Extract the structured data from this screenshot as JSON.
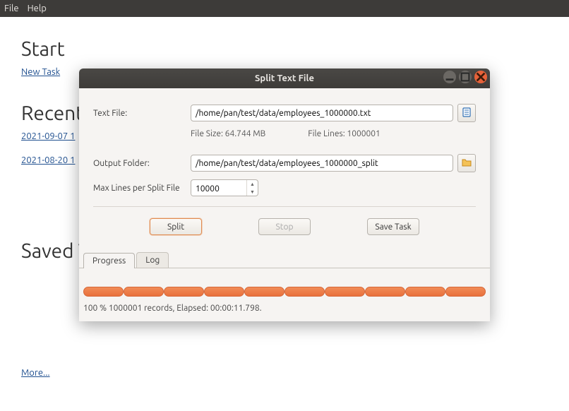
{
  "menubar": {
    "file": "File",
    "help": "Help"
  },
  "start": {
    "heading": "Start",
    "new_task": "New Task"
  },
  "recent": {
    "heading": "Recent",
    "items": [
      "2021-09-07 1",
      "2021-08-20 1"
    ]
  },
  "saved": {
    "heading": "Saved T",
    "more": "More..."
  },
  "dialog": {
    "title": "Split Text File",
    "labels": {
      "text_file": "Text File:",
      "output_folder": "Output Folder:",
      "max_lines": "Max Lines per Split File"
    },
    "text_file_path": "/home/pan/test/data/employees_1000000.txt",
    "output_folder_path": "/home/pan/test/data/employees_1000000_split",
    "file_size_label": "File Size: 64.744 MB",
    "file_lines_label": "File Lines: 1000001",
    "max_lines_value": "10000",
    "buttons": {
      "split": "Split",
      "stop": "Stop",
      "save_task": "Save Task"
    },
    "tabs": {
      "progress": "Progress",
      "log": "Log"
    },
    "progress_text": "100 %    1000001 records,    Elapsed: 00:00:11.798.",
    "icons": {
      "browse_file": "browse-file-icon",
      "browse_folder": "browse-folder-icon"
    }
  }
}
